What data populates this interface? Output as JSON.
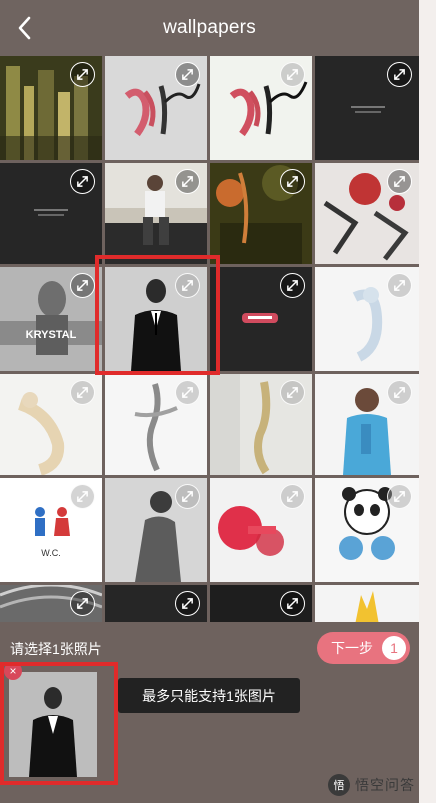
{
  "header": {
    "title": "wallpapers",
    "back_icon": "chevron-left-icon"
  },
  "grid": {
    "tiles": [
      {
        "id": "t1",
        "expand_icon": "expand-icon"
      },
      {
        "id": "t2",
        "expand_icon": "expand-icon"
      },
      {
        "id": "t3",
        "expand_icon": "expand-icon"
      },
      {
        "id": "t4",
        "expand_icon": "expand-icon"
      },
      {
        "id": "t5",
        "expand_icon": "expand-icon"
      },
      {
        "id": "t6",
        "expand_icon": "expand-icon"
      },
      {
        "id": "t7",
        "expand_icon": "expand-icon"
      },
      {
        "id": "t8",
        "expand_icon": "expand-icon"
      },
      {
        "id": "t9",
        "expand_icon": "expand-icon"
      },
      {
        "id": "t10",
        "expand_icon": "expand-icon",
        "selected": true
      },
      {
        "id": "t11",
        "expand_icon": "expand-icon"
      },
      {
        "id": "t12",
        "expand_icon": "expand-icon"
      }
    ],
    "text_in_images": {
      "krystal": "KRYSTAL",
      "wc": "W.C."
    }
  },
  "bottom": {
    "hint": "请选择1张照片",
    "next_label": "下一步",
    "selected_count": "1",
    "toast": "最多只能支持1张图片",
    "remove_icon": "close-icon",
    "remove_glyph": "×"
  },
  "watermark": {
    "text": "悟空问答",
    "logo_glyph": "悟"
  },
  "colors": {
    "accent": "#e8737f",
    "header": "#6f6460",
    "highlight": "#e02b2b"
  }
}
